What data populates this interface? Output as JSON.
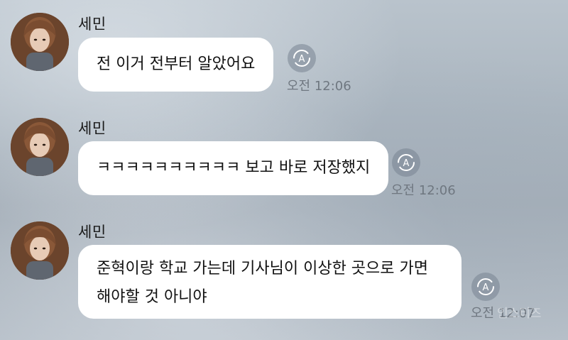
{
  "messages": [
    {
      "sender": "세민",
      "lines": [
        "전 이거 전부터 알았어요"
      ],
      "time": "오전 12:06"
    },
    {
      "sender": "세민",
      "lines": [
        "ㅋㅋㅋㅋㅋㅋㅋㅋㅋㅋ 보고 바로 저장했지"
      ],
      "time": "오전 12:06"
    },
    {
      "sender": "세민",
      "lines": [
        "준혁이랑 학교 가는데 기사님이 이상한 곳으로 가면",
        "해야할 것 아니야"
      ],
      "time": "오전 12:07"
    }
  ],
  "translate_icon": "auto-translate-icon",
  "watermark": "인스티즈",
  "colors": {
    "bubble": "#ffffff",
    "time_text": "#6f7780",
    "icon_bg": "#7884919c"
  }
}
